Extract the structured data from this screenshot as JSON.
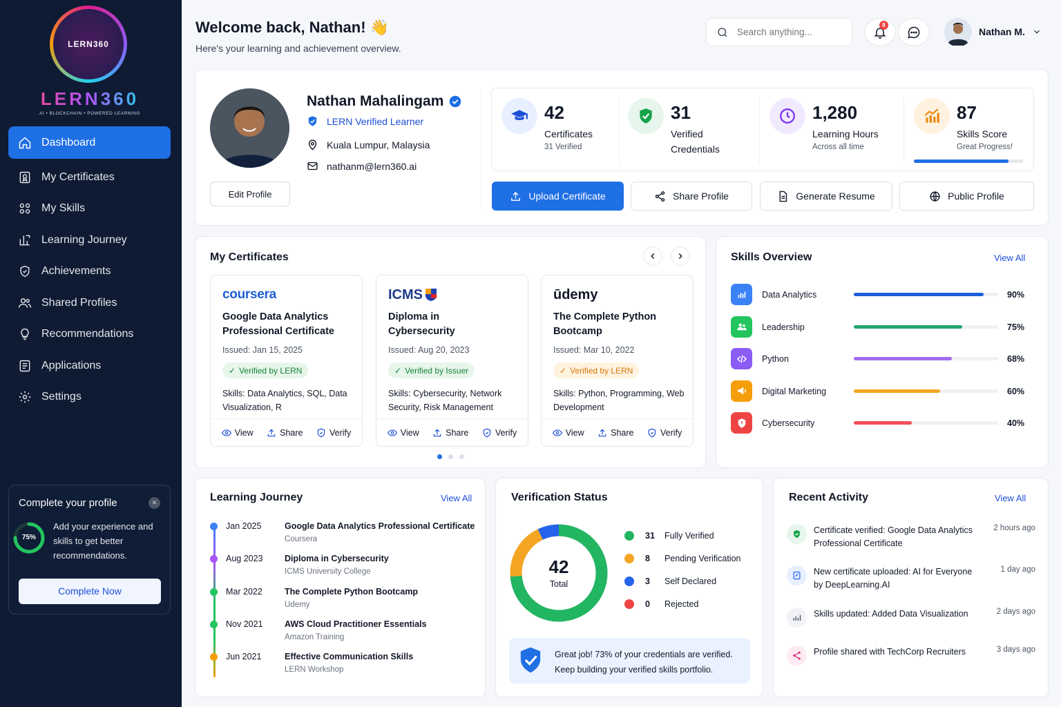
{
  "app": {
    "logo_text": "LERN360",
    "logo_tagline": "AI • BLOCKCHAIN • POWERED LEARNING"
  },
  "sidebar": {
    "items": [
      {
        "label": "Dashboard",
        "icon": "home-icon",
        "active": true
      },
      {
        "label": "My Certificates",
        "icon": "certificate-icon"
      },
      {
        "label": "My Skills",
        "icon": "skills-icon"
      },
      {
        "label": "Learning Journey",
        "icon": "journey-icon"
      },
      {
        "label": "Achievements",
        "icon": "trophy-icon"
      },
      {
        "label": "Shared Profiles",
        "icon": "users-icon"
      },
      {
        "label": "Recommendations",
        "icon": "lightbulb-icon"
      },
      {
        "label": "Applications",
        "icon": "briefcase-icon"
      },
      {
        "label": "Settings",
        "icon": "gear-icon"
      }
    ],
    "complete_profile": {
      "title": "Complete your profile",
      "percent_label": "75%",
      "percent": 75,
      "text": "Add your experience and skills to get better recommendations.",
      "button": "Complete Now"
    }
  },
  "header": {
    "title": "Welcome back, Nathan! 👋",
    "subtitle": "Here's your learning and achievement overview.",
    "search_placeholder": "Search anything...",
    "notification_count": "8",
    "user_name": "Nathan M."
  },
  "profile": {
    "name": "Nathan Mahalingam",
    "verified_label": "LERN Verified Learner",
    "location": "Kuala Lumpur, Malaysia",
    "email": "nathanm@lern360.ai",
    "edit_button": "Edit Profile",
    "stats": [
      {
        "value": "42",
        "label": "Certificates",
        "sub": "31 Verified",
        "icon": "graduation-cap-icon",
        "color": "#1d4ed8",
        "bg": "#e8f0ff"
      },
      {
        "value": "31",
        "label": "Verified Credentials",
        "sub": "",
        "icon": "shield-check-icon",
        "color": "#16a34a",
        "bg": "#e6f6ec"
      },
      {
        "value": "1,280",
        "label": "Learning Hours",
        "sub": "Across all time",
        "icon": "clock-icon",
        "color": "#7c3aed",
        "bg": "#f1eafe"
      },
      {
        "value": "87",
        "label": "Skills Score",
        "sub": "Great Progress!",
        "icon": "chart-up-icon",
        "color": "#ea8a0c",
        "bg": "#fff1e0",
        "progress": 0.87
      }
    ],
    "actions": {
      "upload": "Upload Certificate",
      "share": "Share Profile",
      "resume": "Generate Resume",
      "public": "Public Profile"
    }
  },
  "certificates": {
    "title": "My Certificates",
    "items": [
      {
        "brand": "coursera",
        "title": "Google Data Analytics Professional Certificate",
        "issued": "Issued: Jan 15, 2025",
        "badge": "Verified by LERN",
        "badge_color": "#15803d",
        "badge_bg": "#e7f6ea",
        "skills": "Skills: Data Analytics, SQL, Data Visualization, R"
      },
      {
        "brand": "ICMS",
        "title": "Diploma in Cybersecurity",
        "issued": "Issued: Aug 20, 2023",
        "badge": "Verified by Issuer",
        "badge_color": "#15803d",
        "badge_bg": "#e7f6ea",
        "skills": "Skills: Cybersecurity, Network Security, Risk Management"
      },
      {
        "brand": "ūdemy",
        "title": "The Complete Python Bootcamp",
        "issued": "Issued: Mar 10, 2022",
        "badge": "Verified by LERN",
        "badge_color": "#d97706",
        "badge_bg": "#fff3e0",
        "skills": "Skills: Python, Programming, Web Development"
      }
    ],
    "action_view": "View",
    "action_share": "Share",
    "action_verify": "Verify"
  },
  "skills": {
    "title": "Skills Overview",
    "view_all": "View All",
    "items": [
      {
        "name": "Data Analytics",
        "percent_label": "90%",
        "value": 90,
        "color": "#1d5fd6",
        "icon_bg": "#3b82f6",
        "icon": "bar-chart-icon"
      },
      {
        "name": "Leadership",
        "percent_label": "75%",
        "value": 75,
        "color": "#22a66a",
        "icon_bg": "#22c55e",
        "icon": "team-icon"
      },
      {
        "name": "Python",
        "percent_label": "68%",
        "value": 68,
        "color": "#9f6cf0",
        "icon_bg": "#8b5cf6",
        "icon": "code-icon"
      },
      {
        "name": "Digital Marketing",
        "percent_label": "60%",
        "value": 60,
        "color": "#f5a524",
        "icon_bg": "#f59e0b",
        "icon": "megaphone-icon"
      },
      {
        "name": "Cybersecurity",
        "percent_label": "40%",
        "value": 40,
        "color": "#ef4e5a",
        "icon_bg": "#ef4444",
        "icon": "shield-icon"
      }
    ]
  },
  "journey": {
    "title": "Learning Journey",
    "view_all": "View All",
    "items": [
      {
        "date": "Jan 2025",
        "title": "Google Data Analytics Professional Certificate",
        "org": "Coursera",
        "color": "#3b82f6"
      },
      {
        "date": "Aug 2023",
        "title": "Diploma in Cybersecurity",
        "org": "ICMS University College",
        "color": "#a855f7"
      },
      {
        "date": "Mar 2022",
        "title": "The Complete Python Bootcamp",
        "org": "Udemy",
        "color": "#22c55e"
      },
      {
        "date": "Nov 2021",
        "title": "AWS Cloud Practitioner Essentials",
        "org": "Amazon Training",
        "color": "#22c55e"
      },
      {
        "date": "Jun 2021",
        "title": "Effective Communication Skills",
        "org": "LERN Workshop",
        "color": "#f59e0b"
      }
    ]
  },
  "verification": {
    "title": "Verification Status",
    "total": "42",
    "total_label": "Total",
    "legend": [
      {
        "count": "31",
        "label": "Fully Verified",
        "value": 31,
        "color": "#22b562"
      },
      {
        "count": "8",
        "label": "Pending Verification",
        "value": 8,
        "color": "#f5a524"
      },
      {
        "count": "3",
        "label": "Self Declared",
        "value": 3,
        "color": "#2563eb"
      },
      {
        "count": "0",
        "label": "Rejected",
        "value": 0,
        "color": "#ef4444"
      }
    ],
    "message": "Great job! 73% of your credentials are verified. Keep building your verified skills portfolio."
  },
  "activity": {
    "title": "Recent Activity",
    "view_all": "View All",
    "items": [
      {
        "text": "Certificate verified: Google Data Analytics Professional Certificate",
        "time": "2 hours ago",
        "icon": "shield-check-icon",
        "color": "#16a34a",
        "bg": "#e6f6ec"
      },
      {
        "text": "New certificate uploaded: AI for Everyone by DeepLearning.AI",
        "time": "1 day ago",
        "icon": "upload-icon",
        "color": "#2563eb",
        "bg": "#e8f0ff"
      },
      {
        "text": "Skills updated: Added Data Visualization",
        "time": "2 days ago",
        "icon": "chart-icon",
        "color": "#6b7280",
        "bg": "#f1f3f7"
      },
      {
        "text": "Profile shared with TechCorp Recruiters",
        "time": "3 days ago",
        "icon": "share-icon",
        "color": "#db2777",
        "bg": "#fdeaf3"
      }
    ]
  }
}
